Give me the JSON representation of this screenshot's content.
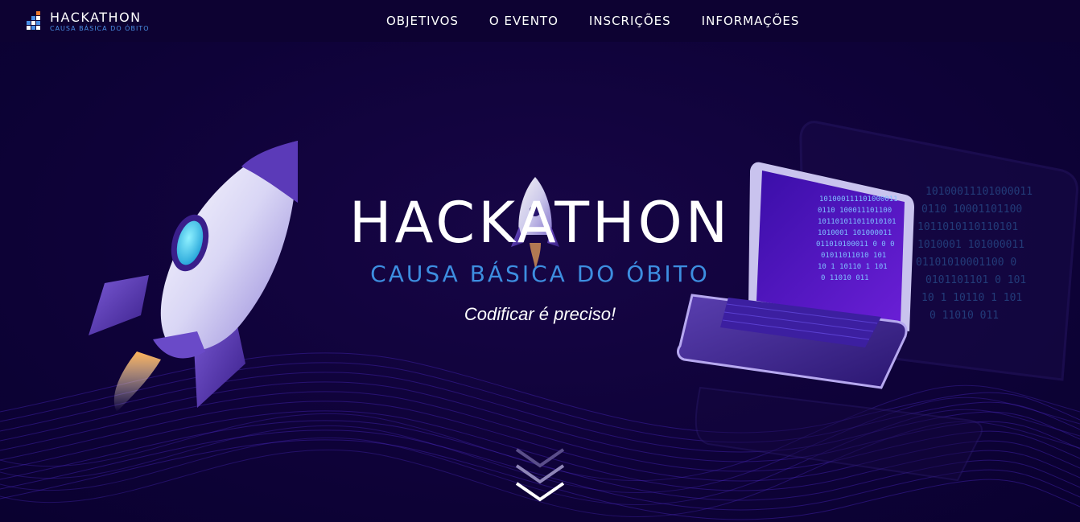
{
  "header": {
    "logo": {
      "title": "HACKATHON",
      "subtitle": "CAUSA BÁSICA DO ÓBITO"
    },
    "nav": [
      {
        "label": "OBJETIVOS"
      },
      {
        "label": "O EVENTO"
      },
      {
        "label": "INSCRIÇÕES"
      },
      {
        "label": "INFORMAÇÕES"
      }
    ]
  },
  "hero": {
    "title": "HACKATHON",
    "subtitle": "CAUSA BÁSICA DO ÓBITO",
    "tagline": "Codificar é preciso!",
    "scroll_icon": "double-chevron-down-icon",
    "binary_screen": [
      "101000111101000011",
      "0110  100011101100",
      "101101011011010101",
      "1010001  101000011",
      "011010100011 0 0 0",
      "01011011010   101",
      "10  1  10110 1 101",
      "0         11010 011"
    ]
  },
  "colors": {
    "background": "#0e0238",
    "accent_blue": "#3d8ee0",
    "text": "#ffffff"
  }
}
